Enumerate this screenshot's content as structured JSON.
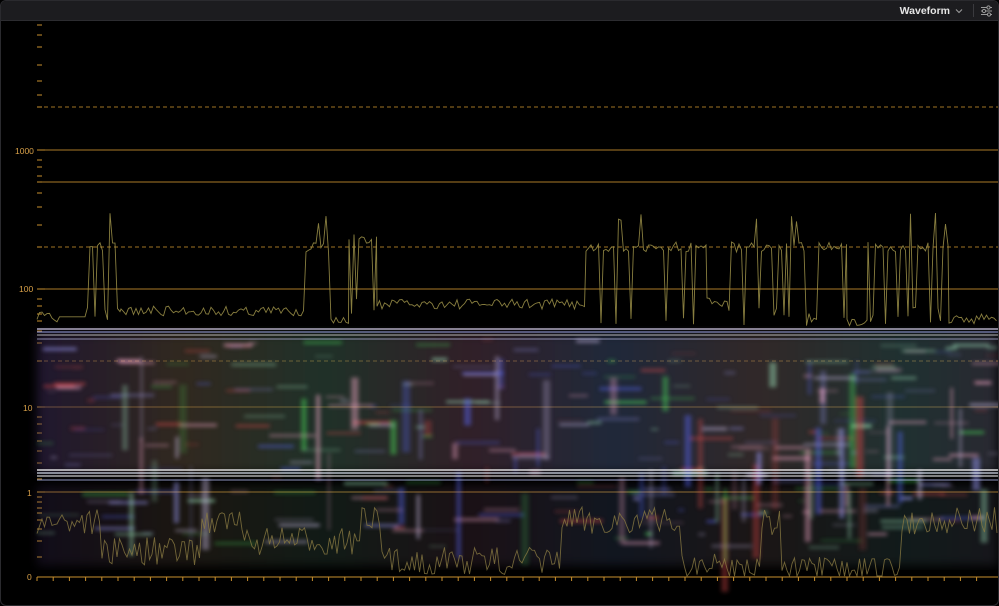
{
  "toolbar": {
    "scope_mode_label": "Waveform",
    "scope_mode_icon": "chevron-down-icon",
    "settings_icon": "sliders-icon"
  },
  "scope": {
    "scale": "log",
    "scale_labels": [
      "1000",
      "100",
      "10",
      "1",
      "0"
    ],
    "graticule_color": "#c8902e",
    "reference_levels": {
      "solid": [
        1000,
        600,
        100,
        10,
        1
      ],
      "dashed": [
        2000,
        200,
        25
      ]
    }
  }
}
